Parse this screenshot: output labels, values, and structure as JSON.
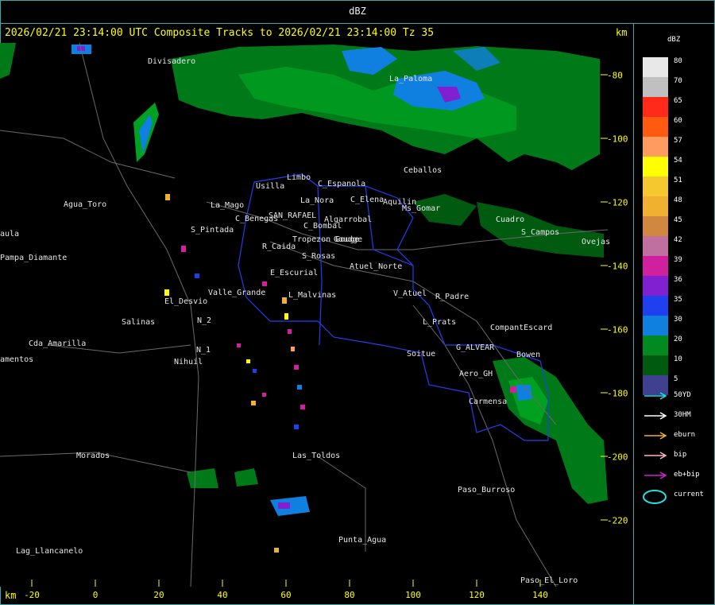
{
  "window": {
    "title": "dBZ"
  },
  "header": {
    "text": "2026/02/21 23:14:00 UTC Composite Tracks to 2026/02/21 23:14:00 Tz 35",
    "km_label": "km"
  },
  "axes": {
    "x_unit": "km",
    "x_ticks": [
      "-20",
      "0",
      "20",
      "40",
      "60",
      "80",
      "100",
      "120",
      "140"
    ],
    "y_ticks": [
      "-80",
      "-100",
      "-120",
      "-140",
      "-160",
      "-180",
      "-200",
      "-220"
    ]
  },
  "places": [
    "Divisadero",
    "Agua_Toro",
    "Pampa_Diamante",
    "Cda_Amarilla",
    "amentos",
    "Morados",
    "Lag_Llancanelo",
    "Salinas",
    "El_Desvio",
    "Valle_Grande",
    "N_2",
    "N_1",
    "Nihuil",
    "S_Pintada",
    "Usilla",
    "Limbo",
    "C_Espanola",
    "La_Nora",
    "C_Elena",
    "Aquilin",
    "Ms_Gomar",
    "C_Benegas",
    "SAN_RAFAEL",
    "Algarrobal",
    "C_Bombal",
    "Tropezon Gouge",
    "R_Caida",
    "S_Rosas",
    "Atuel_Norte",
    "E_Escurial",
    "L_Malvinas",
    "V_Atuel",
    "R_Padre",
    "L_Prats",
    "CompantEscard",
    "G_ALVEAR",
    "Soitue",
    "Bowen",
    "Aero_GH",
    "Carmensa",
    "Las_Toldos",
    "Paso_Burroso",
    "Punta_Agua",
    "Paso_El_Loro",
    "Ceballos",
    "Ovejas",
    "La_Paloma",
    "Cuadro",
    "Goudge",
    "S_Campos",
    "aula",
    "La_Mago"
  ],
  "legend": {
    "title": "dBZ",
    "colors": [
      {
        "label": "80",
        "color": "#e8e8e8"
      },
      {
        "label": "70",
        "color": "#c0c0c0"
      },
      {
        "label": "65",
        "color": "#ff2a1a"
      },
      {
        "label": "60",
        "color": "#ff5a10"
      },
      {
        "label": "57",
        "color": "#ff9a60"
      },
      {
        "label": "54",
        "color": "#ffff00"
      },
      {
        "label": "51",
        "color": "#f5c830"
      },
      {
        "label": "48",
        "color": "#f0b030"
      },
      {
        "label": "45",
        "color": "#d08840"
      },
      {
        "label": "42",
        "color": "#c070a0"
      },
      {
        "label": "39",
        "color": "#d020a0"
      },
      {
        "label": "36",
        "color": "#8020d0"
      },
      {
        "label": "35",
        "color": "#2040f0"
      },
      {
        "label": "30",
        "color": "#1080e0"
      },
      {
        "label": "20",
        "color": "#008a20"
      },
      {
        "label": "10",
        "color": "#005a10"
      },
      {
        "label": "5",
        "color": "#404090"
      }
    ],
    "tracks": [
      {
        "label": "50YD",
        "color": "#20e0e0"
      },
      {
        "label": "30HM",
        "color": "#ffffff"
      },
      {
        "label": "eburn",
        "color": "#f0b030"
      },
      {
        "label": "bip",
        "color": "#ffb0d0"
      },
      {
        "label": "eb+bip",
        "color": "#d020d0"
      },
      {
        "label": "current",
        "color": "#20e0e0"
      }
    ]
  }
}
